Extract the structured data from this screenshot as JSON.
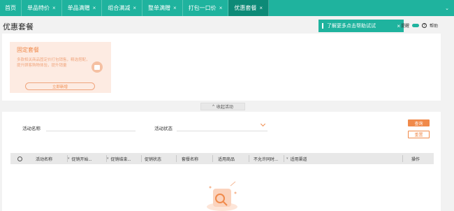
{
  "tabs": [
    {
      "label": "首页",
      "closable": false,
      "active": false
    },
    {
      "label": "单品特价",
      "closable": true,
      "active": false
    },
    {
      "label": "单品满赠",
      "closable": true,
      "active": false
    },
    {
      "label": "组合满减",
      "closable": true,
      "active": false
    },
    {
      "label": "整单满赠",
      "closable": true,
      "active": false
    },
    {
      "label": "打包一口价",
      "closable": true,
      "active": false
    },
    {
      "label": "优惠套餐",
      "closable": true,
      "active": true
    }
  ],
  "tab_close_glyph": "×",
  "tabbar_more_glyph": "⌄",
  "page": {
    "title": "优惠套餐"
  },
  "tip": {
    "text": "了解更多点击帮助试试",
    "close": "×"
  },
  "header": {
    "remind_label": "提醒",
    "help_label": "帮助",
    "help_icon": "?"
  },
  "card": {
    "title": "固定套餐",
    "desc": "多款相关商品固定价打包销售，精选搭配，提升顾客购物体验，提升销量",
    "new_button": "立即新增"
  },
  "collapse": {
    "label": "收起活动",
    "icon": "^"
  },
  "filters": {
    "name_label": "活动名称",
    "status_label": "活动状态"
  },
  "buttons": {
    "query": "查询",
    "reset": "重置"
  },
  "table": {
    "columns": [
      "活动名称",
      "促销开始...",
      "促销结束...",
      "促销状态",
      "套餐名称",
      "适用商品",
      "不允许同时...",
      "适用渠道",
      "操作"
    ]
  },
  "colors": {
    "brand": "#1fb39e",
    "brand_dark": "#0d8a77",
    "accent": "#f08a4b",
    "card_bg": "#fdebe2"
  }
}
